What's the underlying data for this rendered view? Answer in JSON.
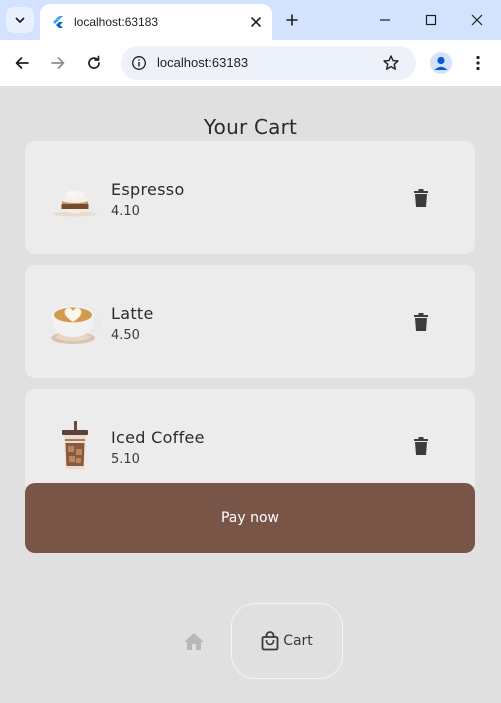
{
  "browser": {
    "tab_title": "localhost:63183",
    "url": "localhost:63183",
    "icons": {
      "tab_search": "chevron-down-icon",
      "favicon": "flutter-icon",
      "tab_close": "close-icon",
      "new_tab": "plus-icon",
      "minimize": "minimize-icon",
      "maximize": "maximize-icon",
      "window_close": "close-icon",
      "back": "arrow-left-icon",
      "forward": "arrow-right-icon",
      "reload": "reload-icon",
      "site_info": "info-icon",
      "bookmark": "star-icon",
      "profile": "account-icon",
      "menu": "kebab-menu-icon"
    }
  },
  "page": {
    "title": "Your Cart"
  },
  "cart": {
    "items": [
      {
        "name": "Espresso",
        "price": "4.10",
        "image": "espresso-image",
        "delete_icon": "trash-icon"
      },
      {
        "name": "Latte",
        "price": "4.50",
        "image": "latte-image",
        "delete_icon": "trash-icon"
      },
      {
        "name": "Iced Coffee",
        "price": "5.10",
        "image": "iced-coffee-image",
        "delete_icon": "trash-icon"
      }
    ]
  },
  "pay_button": {
    "label": "Pay now",
    "color": "#795548"
  },
  "bottom_nav": {
    "home_icon": "home-icon",
    "cart_icon": "shopping-bag-icon",
    "cart_label": "Cart",
    "active": "Cart"
  },
  "colors": {
    "background": "#e0e0e0",
    "card": "#ececec",
    "accent": "#795548",
    "browser_frame": "#d3e3fd"
  }
}
